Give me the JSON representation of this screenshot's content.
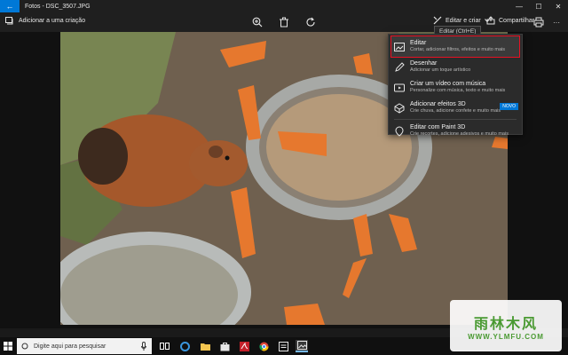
{
  "window": {
    "title": "Fotos - DSC_3507.JPG",
    "back_glyph": "←",
    "min_glyph": "—",
    "max_glyph": "☐",
    "close_glyph": "✕"
  },
  "toolbar": {
    "add_to_label": "Adicionar a uma criação",
    "edit_create_label": "Editar e criar",
    "share_label": "Compartilhar",
    "more_glyph": "···"
  },
  "tooltip": {
    "text": "Editar (Ctrl+E)"
  },
  "menu": {
    "items": [
      {
        "label": "Editar",
        "sub": "Cortar, adicionar filtros, efeitos e muito mais",
        "icon": "image-edit-icon"
      },
      {
        "label": "Desenhar",
        "sub": "Adicionar um toque artístico",
        "icon": "pen-icon"
      },
      {
        "label": "Criar um vídeo com música",
        "sub": "Personalize com música, texto e muito mais",
        "icon": "video-icon"
      },
      {
        "label": "Adicionar efeitos 3D",
        "sub": "Crie chuva, adicione confete e muito mais",
        "icon": "3d-effects-icon",
        "badge": "NOVO"
      },
      {
        "label": "Editar com Paint 3D",
        "sub": "Crie recortes, adicione adesivos e muito mais",
        "icon": "paint3d-icon"
      }
    ]
  },
  "taskbar": {
    "search_placeholder": "Digite aqui para pesquisar"
  },
  "watermark": {
    "chinese": "雨林木风",
    "url": "WWW.YLMFU.COM"
  },
  "colors": {
    "accent": "#0078d7",
    "highlight": "#e81123",
    "badge": "#0078d7"
  }
}
